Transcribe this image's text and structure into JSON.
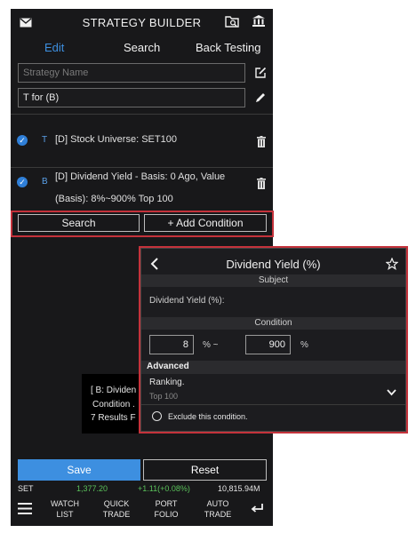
{
  "header": {
    "title": "STRATEGY BUILDER"
  },
  "tabs": [
    {
      "label": "Edit"
    },
    {
      "label": "Search"
    },
    {
      "label": "Back Testing"
    }
  ],
  "form": {
    "name_placeholder": "Strategy Name",
    "formula_value": "T for (B)"
  },
  "conditions": [
    {
      "tag": "T",
      "line1": "[D] Stock Universe: SET100",
      "line2": ""
    },
    {
      "tag": "B",
      "line1": "[D] Dividend Yield - Basis: 0  Ago, Value",
      "line2": "(Basis): 8%~900% Top 100"
    }
  ],
  "actions": {
    "search_label": "Search",
    "add_condition_label": "+ Add Condition"
  },
  "results_tooltip": {
    "line1": "[ B: Dividen",
    "line2": "Condition .",
    "line3": "7 Results F"
  },
  "popup": {
    "title": "Dividend Yield (%)",
    "subject_header": "Subject",
    "subject_label": "Dividend Yield (%):",
    "condition_header": "Condition",
    "min_value": "8",
    "range_sep": "% ~",
    "max_value": "900",
    "max_unit": "%",
    "advanced_label": "Advanced",
    "ranking_label": "Ranking.",
    "ranking_value": "Top 100",
    "exclude_label": "Exclude this condition."
  },
  "bottom_buttons": {
    "save_label": "Save",
    "reset_label": "Reset"
  },
  "ticker": {
    "symbol": "SET",
    "price": "1,377.20",
    "change": "+1.11(+0.08%)",
    "volume": "10,815.94M"
  },
  "nav": [
    {
      "line1": "WATCH",
      "line2": "LIST"
    },
    {
      "line1": "QUICK",
      "line2": "TRADE"
    },
    {
      "line1": "PORT",
      "line2": "FOLIO"
    },
    {
      "line1": "AUTO",
      "line2": "TRADE"
    }
  ],
  "colors": {
    "accent_blue": "#3d8fe0",
    "highlight_red": "#c4323b",
    "up_green": "#5ac15a",
    "background": "#18181a"
  }
}
